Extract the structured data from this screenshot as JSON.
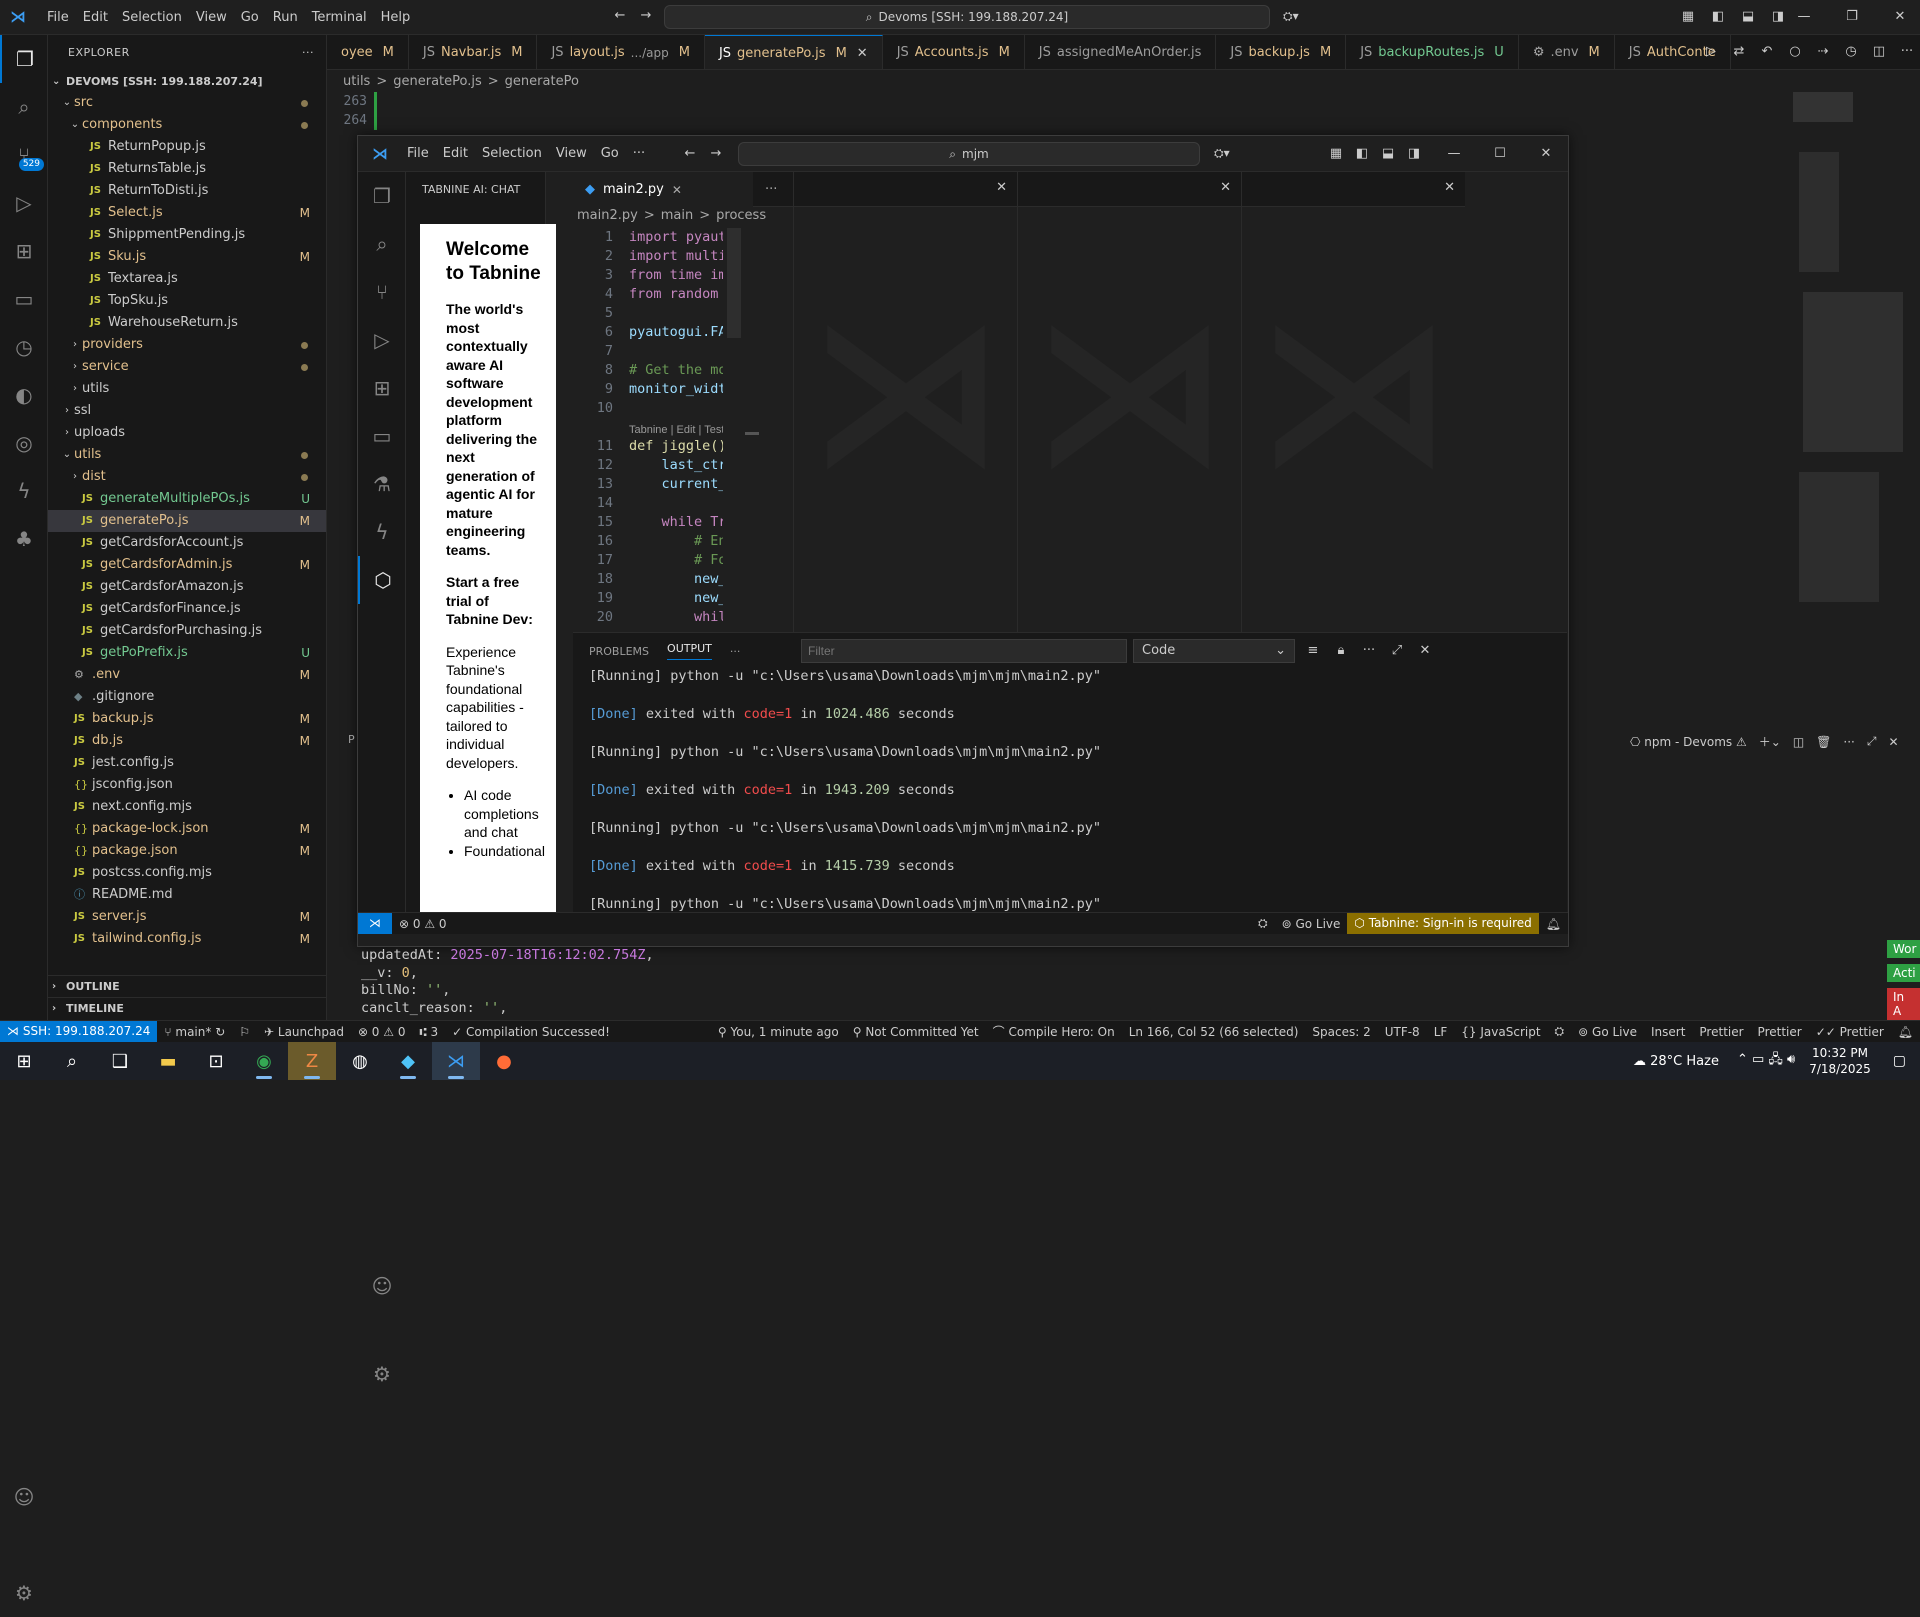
{
  "titlebar": {
    "menus": [
      "File",
      "Edit",
      "Selection",
      "View",
      "Go",
      "Run",
      "Terminal",
      "Help"
    ],
    "search": "Devoms [SSH: 199.188.207.24]"
  },
  "explorer": {
    "title": "EXPLORER",
    "root": "DEVOMS [SSH: 199.188.207.24]",
    "items": [
      {
        "name": "src",
        "type": "folder",
        "open": true,
        "indent": 1,
        "status": "dot"
      },
      {
        "name": "components",
        "type": "folder",
        "open": true,
        "indent": 2,
        "status": "dot"
      },
      {
        "name": "ReturnPopup.js",
        "type": "js",
        "indent": 3,
        "status": ""
      },
      {
        "name": "ReturnsTable.js",
        "type": "js",
        "indent": 3,
        "status": ""
      },
      {
        "name": "ReturnToDisti.js",
        "type": "js",
        "indent": 3,
        "status": ""
      },
      {
        "name": "Select.js",
        "type": "js",
        "indent": 3,
        "status": "M"
      },
      {
        "name": "ShippmentPending.js",
        "type": "js",
        "indent": 3,
        "status": ""
      },
      {
        "name": "Sku.js",
        "type": "js",
        "indent": 3,
        "status": "M"
      },
      {
        "name": "Textarea.js",
        "type": "js",
        "indent": 3,
        "status": ""
      },
      {
        "name": "TopSku.js",
        "type": "js",
        "indent": 3,
        "status": ""
      },
      {
        "name": "WarehouseReturn.js",
        "type": "js",
        "indent": 3,
        "status": ""
      },
      {
        "name": "providers",
        "type": "folder",
        "open": false,
        "indent": 2,
        "status": "dot"
      },
      {
        "name": "service",
        "type": "folder",
        "open": false,
        "indent": 2,
        "status": "dot"
      },
      {
        "name": "utils",
        "type": "folder",
        "open": false,
        "indent": 2,
        "status": ""
      },
      {
        "name": "ssl",
        "type": "folder",
        "open": false,
        "indent": 1,
        "status": ""
      },
      {
        "name": "uploads",
        "type": "folder",
        "open": false,
        "indent": 1,
        "status": ""
      },
      {
        "name": "utils",
        "type": "folder",
        "open": true,
        "indent": 1,
        "status": "dot"
      },
      {
        "name": "dist",
        "type": "folder",
        "open": false,
        "indent": 2,
        "status": "dot"
      },
      {
        "name": "generateMultiplePOs.js",
        "type": "js",
        "indent": 2,
        "status": "U"
      },
      {
        "name": "generatePo.js",
        "type": "js",
        "indent": 2,
        "status": "M",
        "selected": true
      },
      {
        "name": "getCardsforAccount.js",
        "type": "js",
        "indent": 2,
        "status": ""
      },
      {
        "name": "getCardsforAdmin.js",
        "type": "js",
        "indent": 2,
        "status": "M"
      },
      {
        "name": "getCardsforAmazon.js",
        "type": "js",
        "indent": 2,
        "status": ""
      },
      {
        "name": "getCardsforFinance.js",
        "type": "js",
        "indent": 2,
        "status": ""
      },
      {
        "name": "getCardsforPurchasing.js",
        "type": "js",
        "indent": 2,
        "status": ""
      },
      {
        "name": "getPoPrefix.js",
        "type": "js",
        "indent": 2,
        "status": "U"
      },
      {
        "name": ".env",
        "type": "gear",
        "indent": 1,
        "status": "M"
      },
      {
        "name": ".gitignore",
        "type": "git",
        "indent": 1,
        "status": ""
      },
      {
        "name": "backup.js",
        "type": "js",
        "indent": 1,
        "status": "M"
      },
      {
        "name": "db.js",
        "type": "js",
        "indent": 1,
        "status": "M"
      },
      {
        "name": "jest.config.js",
        "type": "js",
        "indent": 1,
        "status": ""
      },
      {
        "name": "jsconfig.json",
        "type": "json",
        "indent": 1,
        "status": ""
      },
      {
        "name": "next.config.mjs",
        "type": "js",
        "indent": 1,
        "status": ""
      },
      {
        "name": "package-lock.json",
        "type": "json",
        "indent": 1,
        "status": "M"
      },
      {
        "name": "package.json",
        "type": "json",
        "indent": 1,
        "status": "M"
      },
      {
        "name": "postcss.config.mjs",
        "type": "js",
        "indent": 1,
        "status": ""
      },
      {
        "name": "README.md",
        "type": "info",
        "indent": 1,
        "status": ""
      },
      {
        "name": "server.js",
        "type": "js",
        "indent": 1,
        "status": "M"
      },
      {
        "name": "tailwind.config.js",
        "type": "js",
        "indent": 1,
        "status": "M"
      }
    ],
    "outline": "OUTLINE",
    "timeline": "TIMELINE"
  },
  "tabs": [
    {
      "label": "oyee",
      "status": "M",
      "cls": "m"
    },
    {
      "label": "Navbar.js",
      "status": "M",
      "cls": "m"
    },
    {
      "label": "layout.js",
      "extra": ".../app",
      "status": "M",
      "cls": "m"
    },
    {
      "label": "generatePo.js",
      "status": "M",
      "cls": "m",
      "active": true
    },
    {
      "label": "Accounts.js",
      "status": "M",
      "cls": "m"
    },
    {
      "label": "assignedMeAnOrder.js",
      "status": "",
      "cls": ""
    },
    {
      "label": "backup.js",
      "status": "M",
      "cls": "m"
    },
    {
      "label": "backupRoutes.js",
      "status": "U",
      "cls": "u"
    },
    {
      "label": ".env",
      "status": "M",
      "cls": ""
    },
    {
      "label": "AuthConte",
      "status": "",
      "cls": "m"
    }
  ],
  "breadcrumb": [
    "utils",
    ">",
    "generatePo.js",
    ">",
    "generatePo"
  ],
  "outer_lines": [
    "263",
    "264"
  ],
  "inner": {
    "menus": [
      "File",
      "Edit",
      "Selection",
      "View",
      "Go",
      "···"
    ],
    "search": "mjm",
    "sidepanel_title": "TABNINE AI: CHAT",
    "welcome": {
      "title": "Welcome to Tabnine",
      "p1": "The world's most contextually aware AI software development platform delivering the next generation of agentic AI for mature engineering teams.",
      "p2": "Start a free trial of Tabnine Dev:",
      "p3": "Experience Tabnine's foundational capabilities - tailored to individual developers.",
      "bullets": [
        "AI code completions and chat",
        "Foundational"
      ]
    },
    "editor_tab": "main2.py",
    "breadcrumb": [
      "main2.py",
      ">",
      "main",
      ">",
      "process"
    ],
    "codelens": "Tabnine | Edit | Test | E",
    "code": [
      {
        "n": "1",
        "t": "import pyautogu"
      },
      {
        "n": "2",
        "t": "import multipro"
      },
      {
        "n": "3",
        "t": "from time impor"
      },
      {
        "n": "4",
        "t": "from random imp"
      },
      {
        "n": "5",
        "t": ""
      },
      {
        "n": "6",
        "t": "pyautogui.FAILS"
      },
      {
        "n": "7",
        "t": ""
      },
      {
        "n": "8",
        "t": "# Get the monit"
      },
      {
        "n": "9",
        "t": "monitor_width,"
      },
      {
        "n": "10",
        "t": ""
      },
      {
        "n": "11",
        "t": "def jiggle() ->"
      },
      {
        "n": "12",
        "t": "    last_ctrl_p"
      },
      {
        "n": "13",
        "t": "    current_x,"
      },
      {
        "n": "14",
        "t": ""
      },
      {
        "n": "15",
        "t": "    while True:"
      },
      {
        "n": "16",
        "t": "        # Ensur"
      },
      {
        "n": "17",
        "t": "        # For e"
      },
      {
        "n": "18",
        "t": "        new_x ="
      },
      {
        "n": "19",
        "t": "        new_y ="
      },
      {
        "n": "20",
        "t": "        while a"
      }
    ],
    "panel_tabs": [
      "PROBLEMS",
      "OUTPUT",
      "···"
    ],
    "filter_placeholder": "Filter",
    "output_channel": "Code",
    "output": [
      {
        "type": "run",
        "text": "[Running] python -u \"c:\\Users\\usama\\Downloads\\mjm\\mjm\\main2.py\""
      },
      {
        "type": "blank",
        "text": ""
      },
      {
        "type": "done",
        "pre": "[Done]",
        "mid": " exited with ",
        "code": "code=1",
        "post": " in ",
        "secs": "1024.486",
        "end": " seconds"
      },
      {
        "type": "blank",
        "text": ""
      },
      {
        "type": "run",
        "text": "[Running] python -u \"c:\\Users\\usama\\Downloads\\mjm\\mjm\\main2.py\""
      },
      {
        "type": "blank",
        "text": ""
      },
      {
        "type": "done",
        "pre": "[Done]",
        "mid": " exited with ",
        "code": "code=1",
        "post": " in ",
        "secs": "1943.209",
        "end": " seconds"
      },
      {
        "type": "blank",
        "text": ""
      },
      {
        "type": "run",
        "text": "[Running] python -u \"c:\\Users\\usama\\Downloads\\mjm\\mjm\\main2.py\""
      },
      {
        "type": "blank",
        "text": ""
      },
      {
        "type": "done",
        "pre": "[Done]",
        "mid": " exited with ",
        "code": "code=1",
        "post": " in ",
        "secs": "1415.739",
        "end": " seconds"
      },
      {
        "type": "blank",
        "text": ""
      },
      {
        "type": "run",
        "text": "[Running] python -u \"c:\\Users\\usama\\Downloads\\mjm\\mjm\\main2.py\""
      }
    ],
    "status": {
      "problems": "⊗ 0 ⚠ 0",
      "golive": "Go Live",
      "tabnine": "Tabnine: Sign-in is required"
    }
  },
  "outer_terminal": {
    "label": "npm - Devoms",
    "lines": [
      {
        "k": "updatedAt: ",
        "v": "2025-07-18T16:12:02.754Z",
        "e": ","
      },
      {
        "k": "__v: ",
        "v": "0",
        "e": ","
      },
      {
        "k": "billNo: ",
        "v": "''",
        "e": ","
      },
      {
        "k": "canclt_reason: ",
        "v": "''",
        "e": ","
      }
    ],
    "side_labels": [
      "Wor",
      "Acti",
      "In A"
    ]
  },
  "status": {
    "remote": "SSH: 199.188.207.24",
    "branch": "main*",
    "launchpad": "Launchpad",
    "problems": "⊗ 0 ⚠ 0",
    "ports": "3",
    "compile": "Compilation Successed!",
    "blame": "You, 1 minute ago",
    "commit": "Not Committed Yet",
    "compilehero": "Compile Hero: On",
    "position": "Ln 166, Col 52 (66 selected)",
    "spaces": "Spaces: 2",
    "encoding": "UTF-8",
    "eol": "LF",
    "language": "JavaScript",
    "golive": "Go Live",
    "insert": "Insert",
    "prettier1": "Prettier",
    "prettier2": "Prettier",
    "prettier3": "Prettier",
    "gitbadge": "529"
  },
  "taskbar": {
    "weather": "28°C  Haze",
    "time": "10:32 PM",
    "date": "7/18/2025"
  },
  "colors": {
    "accent": "#0078d4",
    "modified": "#e2c08d",
    "untracked": "#73c991",
    "js": "#cbcb41",
    "tabnine": "#8b6f00"
  }
}
